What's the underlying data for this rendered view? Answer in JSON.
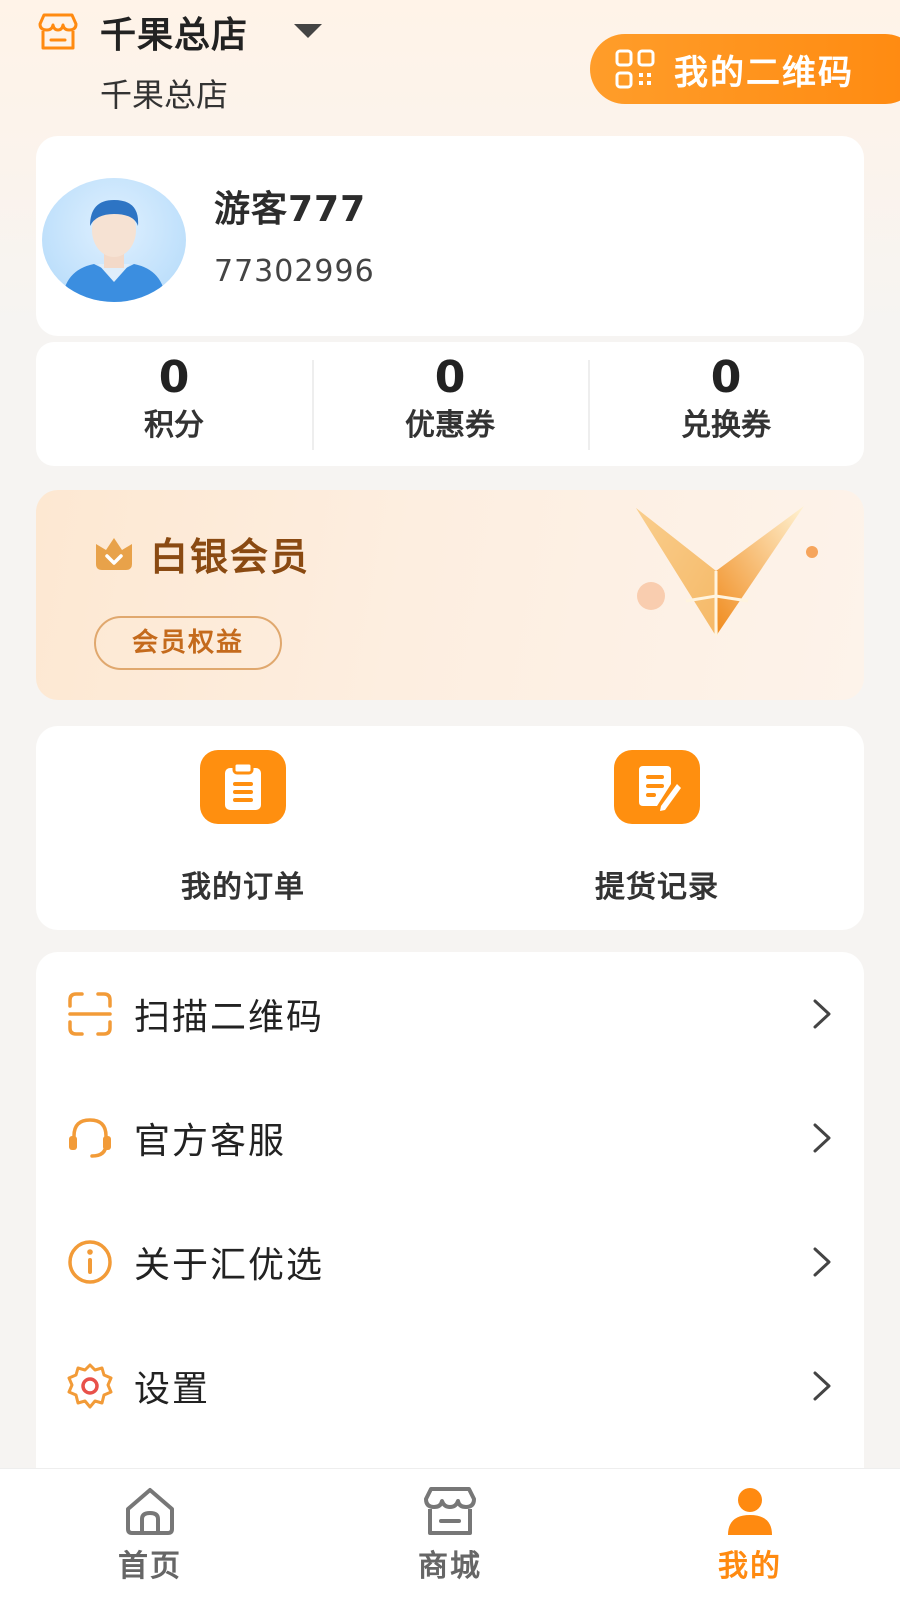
{
  "header": {
    "store_name": "千果总店",
    "store_sub": "千果总店",
    "qr_button_label": "我的二维码",
    "icons": {
      "store": "store-icon",
      "caret": "caret-down-icon",
      "qr": "qr-code-icon"
    }
  },
  "profile": {
    "name": "游客777",
    "id": "77302996",
    "avatar_icon": "avatar-person-icon"
  },
  "stats": [
    {
      "value": "0",
      "label": "积分"
    },
    {
      "value": "0",
      "label": "优惠券"
    },
    {
      "value": "0",
      "label": "兑换券"
    }
  ],
  "member": {
    "title": "白银会员",
    "benefit_label": "会员权益",
    "badge_icon": "crown-badge-icon",
    "art_icon": "silver-v-emblem-icon"
  },
  "actions": [
    {
      "label": "我的订单",
      "icon": "clipboard-icon"
    },
    {
      "label": "提货记录",
      "icon": "edit-note-icon"
    }
  ],
  "menu": [
    {
      "label": "扫描二维码",
      "icon": "scan-icon"
    },
    {
      "label": "官方客服",
      "icon": "headset-icon"
    },
    {
      "label": "关于汇优选",
      "icon": "info-icon"
    },
    {
      "label": "设置",
      "icon": "gear-icon"
    }
  ],
  "bottom_nav": [
    {
      "label": "首页",
      "icon": "home-icon",
      "active": false
    },
    {
      "label": "商城",
      "icon": "shop-icon",
      "active": false
    },
    {
      "label": "我的",
      "icon": "user-icon",
      "active": true
    }
  ],
  "colors": {
    "accent": "#ff8a10",
    "member_text": "#8a4a12",
    "benefit_text": "#c46a1c"
  }
}
